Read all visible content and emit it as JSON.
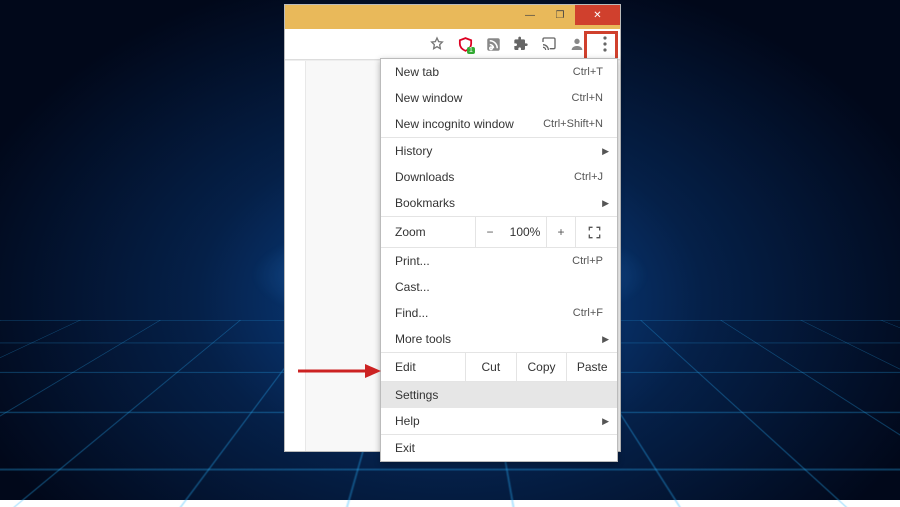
{
  "window_controls": {
    "minimize": "—",
    "maximize": "❐",
    "close": "✕"
  },
  "menu": {
    "group1": [
      {
        "label": "New tab",
        "shortcut": "Ctrl+T"
      },
      {
        "label": "New window",
        "shortcut": "Ctrl+N"
      },
      {
        "label": "New incognito window",
        "shortcut": "Ctrl+Shift+N"
      }
    ],
    "group2": [
      {
        "label": "History",
        "submenu": true
      },
      {
        "label": "Downloads",
        "shortcut": "Ctrl+J"
      },
      {
        "label": "Bookmarks",
        "submenu": true
      }
    ],
    "zoom": {
      "label": "Zoom",
      "minus": "−",
      "value": "100%",
      "plus": "+"
    },
    "group3": [
      {
        "label": "Print...",
        "shortcut": "Ctrl+P"
      },
      {
        "label": "Cast..."
      },
      {
        "label": "Find...",
        "shortcut": "Ctrl+F"
      },
      {
        "label": "More tools",
        "submenu": true
      }
    ],
    "edit": {
      "label": "Edit",
      "cut": "Cut",
      "copy": "Copy",
      "paste": "Paste"
    },
    "group4": [
      {
        "label": "Settings",
        "highlighted": true
      },
      {
        "label": "Help",
        "submenu": true
      }
    ],
    "group5": [
      {
        "label": "Exit"
      }
    ]
  }
}
